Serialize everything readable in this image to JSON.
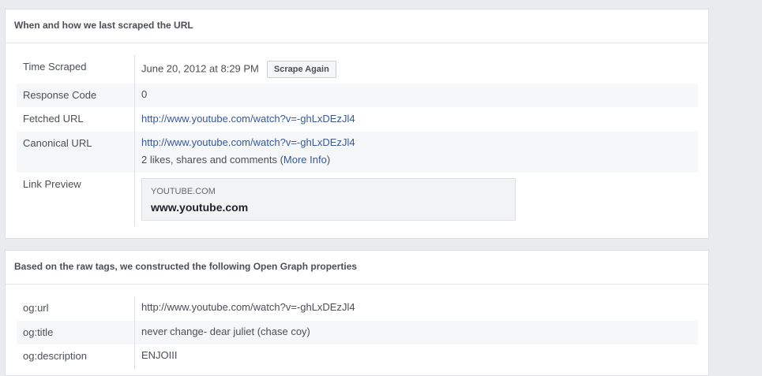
{
  "scrape_panel": {
    "title": "When and how we last scraped the URL",
    "time_scraped": {
      "label": "Time Scraped",
      "value": "June 20, 2012 at 8:29 PM",
      "button": "Scrape Again"
    },
    "response_code": {
      "label": "Response Code",
      "value": "0"
    },
    "fetched_url": {
      "label": "Fetched URL",
      "value": "http://www.youtube.com/watch?v=-ghLxDEzJl4"
    },
    "canonical_url": {
      "label": "Canonical URL",
      "value": "http://www.youtube.com/watch?v=-ghLxDEzJl4",
      "engagement_prefix": "2 likes, shares and comments (",
      "more_info": "More Info",
      "engagement_suffix": ")"
    },
    "link_preview": {
      "label": "Link Preview",
      "domain": "YOUTUBE.COM",
      "title": "www.youtube.com"
    }
  },
  "og_panel": {
    "title": "Based on the raw tags, we constructed the following Open Graph properties",
    "rows": [
      {
        "label": "og:url",
        "value": "http://www.youtube.com/watch?v=-ghLxDEzJl4"
      },
      {
        "label": "og:title",
        "value": "never change- dear juliet (chase coy)"
      },
      {
        "label": "og:description",
        "value": "ENJOIII"
      }
    ]
  },
  "colors": {
    "background": "#e9ebee",
    "panel": "#ffffff",
    "row_shade": "#f6f7f9",
    "link": "#385898",
    "label_text": "#4b4f56"
  }
}
